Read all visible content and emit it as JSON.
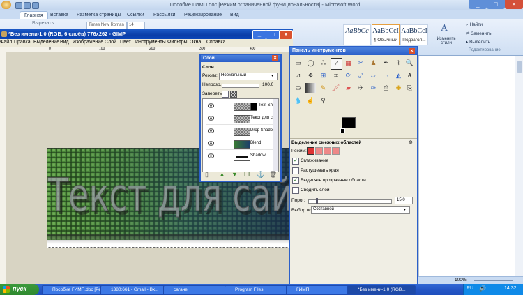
{
  "word": {
    "title": "Пособие ГИМП.doc [Режим ограниченной функциональности] - Microsoft Word",
    "tabs": [
      "Главная",
      "Вставка",
      "Разметка страницы",
      "Ссылки",
      "Рассылки",
      "Рецензирование",
      "Вид"
    ],
    "ribbon": {
      "cut_label": "Вырезать",
      "font_name": "Times New Roman",
      "font_size": "14",
      "styles": [
        {
          "sample": "AaBbCc",
          "label": ""
        },
        {
          "sample": "AaBbCcI",
          "label": "¶ Обычный"
        },
        {
          "sample": "AaBbCcI",
          "label": "Подзагол..."
        }
      ],
      "change_styles": "Изменить стили",
      "find": "Найти",
      "replace": "Заменить",
      "select": "Выделить",
      "editing_group": "Редактирование"
    },
    "status_zoom": "100%"
  },
  "gimp_image": {
    "title": "*Без имени-1.0 (RGB, 6 слоёв) 776x262 - GIMP",
    "menu": [
      "Файл",
      "Правка",
      "Выделение",
      "Вид",
      "Изображение",
      "Слой",
      "Цвет",
      "Инструменты",
      "Фильтры",
      "Окна",
      "Справка"
    ],
    "ruler_marks": [
      "0",
      "100",
      "200",
      "300",
      "400"
    ],
    "canvas_text": "Текст для сайта"
  },
  "layers": {
    "title": "Слои",
    "tab_label": "Слои",
    "mode_label": "Режим:",
    "mode_value": "Нормальный",
    "opacity_label": "Непрозр.:",
    "opacity_value": "100,0",
    "lock_label": "Запереть:",
    "items": [
      {
        "name": "Text Sh"
      },
      {
        "name": "Текст для сайт"
      },
      {
        "name": "Drop Shadow"
      },
      {
        "name": "Blend"
      },
      {
        "name": "Shadow"
      }
    ]
  },
  "toolbox": {
    "title": "Панель инструментов",
    "options_title": "Выделение смежных областей",
    "mode_label": "Режим:",
    "checkboxes": [
      {
        "label": "Сглаживание",
        "checked": true
      },
      {
        "label": "Растушевать края",
        "checked": false
      },
      {
        "label": "Выделять прозрачные области",
        "checked": true
      },
      {
        "label": "Сводить слои",
        "checked": false
      }
    ],
    "threshold_label": "Порог:",
    "threshold_value": "15,0",
    "select_by_label": "Выбор по:",
    "select_by_value": "Составной"
  },
  "taskbar": {
    "start": "пуск",
    "tasks": [
      "Пособие ГИМП.doc [Ре...",
      "1380:661 - Gmail - Вх...",
      "сагане",
      "Program Files",
      "ГИМП",
      "*Без имени-1.0 (RGB..."
    ],
    "lang": "RU",
    "clock": "14:32"
  },
  "colors": {
    "xp_blue": "#2b5fc9",
    "taskbar": "#2456c6",
    "start_green": "#2f8a2f",
    "canvas_green": "#2f6a2a",
    "canvas_blue": "#1e3f7a"
  }
}
